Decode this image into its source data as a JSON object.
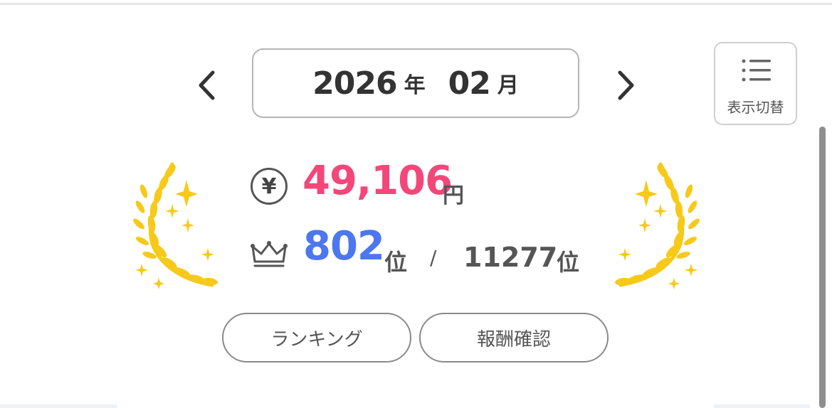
{
  "period": {
    "year": "2026",
    "year_unit": "年",
    "month": "02",
    "month_unit": "月"
  },
  "view_toggle": {
    "label": "表示切替",
    "icon": "list-icon"
  },
  "reward": {
    "icon": "yen-icon",
    "symbol": "¥",
    "value": "49,106",
    "unit": "円",
    "color": "#f3477a"
  },
  "rank": {
    "icon": "crown-icon",
    "value": "802",
    "unit": "位",
    "separator": "/",
    "total": "11277",
    "total_unit": "位",
    "color": "#4c77ee"
  },
  "decoration": {
    "icon": "laurel-sparkle-icon",
    "color": "#f7c919"
  },
  "buttons": {
    "ranking_label": "ランキング",
    "reward_confirm_label": "報酬確認"
  }
}
